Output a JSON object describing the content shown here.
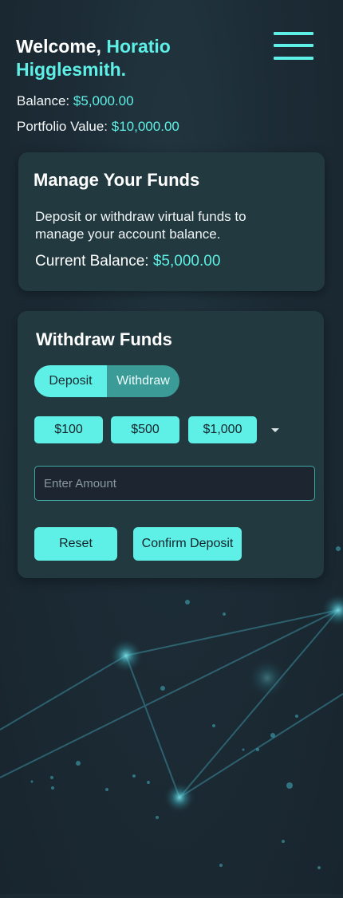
{
  "header": {
    "welcome_prefix": "Welcome,",
    "user_name": "Horatio Higglesmith."
  },
  "stats": {
    "balance_label": "Balance:",
    "balance_value": "$5,000.00",
    "portfolio_label": "Portfolio Value:",
    "portfolio_value": "$10,000.00"
  },
  "menu": {
    "icon": "hamburger-menu-icon"
  },
  "manage_card": {
    "title": "Manage Your Funds",
    "description": "Deposit or withdraw virtual funds to manage your account balance.",
    "current_balance_label": "Current Balance:",
    "current_balance_value": "$5,000.00"
  },
  "withdraw_card": {
    "title": "Withdraw Funds",
    "toggle": {
      "deposit_label": "Deposit",
      "withdraw_label": "Withdraw"
    },
    "quick_amounts": [
      "$100",
      "$500",
      "$1,000"
    ],
    "amount_placeholder": "Enter Amount",
    "reset_label": "Reset",
    "confirm_label": "Confirm Deposit"
  },
  "colors": {
    "accent": "#5ef0e6",
    "card": "#22393f",
    "background": "#1b2a33"
  }
}
